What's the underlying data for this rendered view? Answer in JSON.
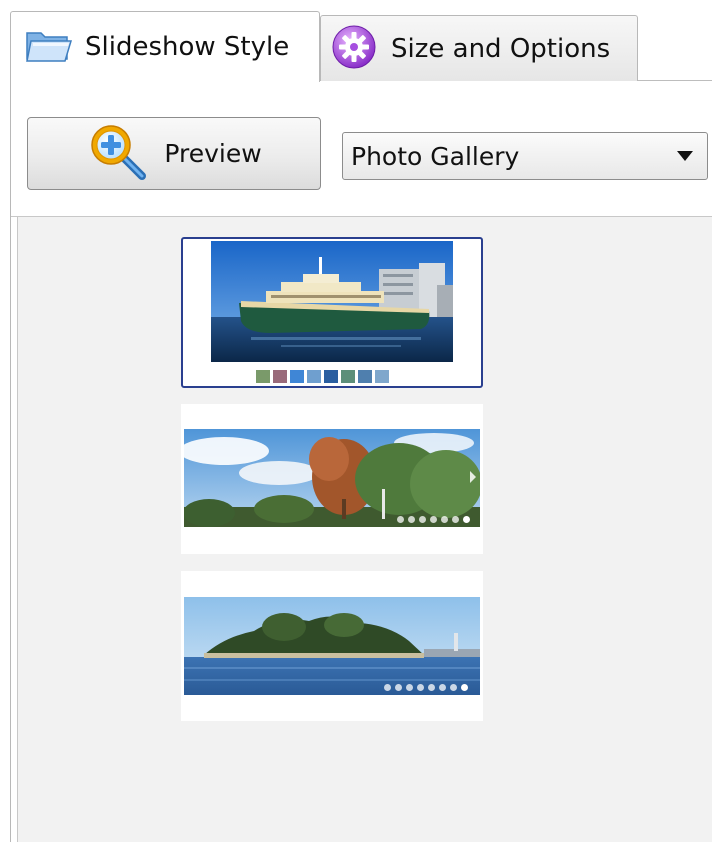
{
  "tabs": [
    {
      "label": "Slideshow Style",
      "icon": "folder-icon",
      "active": true
    },
    {
      "label": "Size and Options",
      "icon": "gear-icon",
      "active": false
    }
  ],
  "toolbar": {
    "preview_label": "Preview",
    "preview_icon": "magnifier-plus-icon",
    "style_select": {
      "value": "Photo Gallery"
    }
  },
  "styles": [
    {
      "id": "photo-gallery",
      "selected": true,
      "thumbnail_count": 8
    },
    {
      "id": "slider-trees",
      "selected": false,
      "dot_count": 7
    },
    {
      "id": "slider-island",
      "selected": false,
      "dot_count": 8
    }
  ],
  "colors": {
    "selection_border": "#2a3f8f",
    "panel_background": "#f2f2f2"
  }
}
